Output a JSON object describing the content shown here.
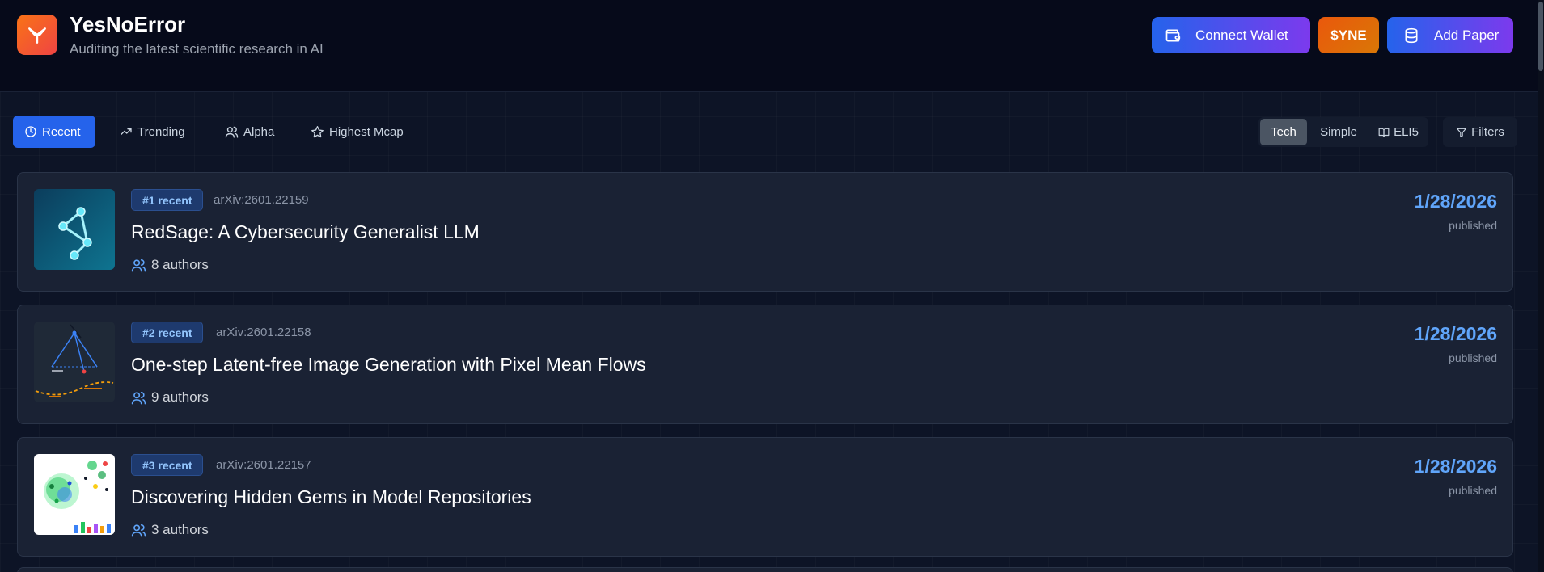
{
  "header": {
    "title": "YesNoError",
    "subtitle": "Auditing the latest scientific research in AI",
    "connect_wallet": "Connect Wallet",
    "token": "$YNE",
    "add_paper": "Add Paper"
  },
  "tabs": {
    "recent": "Recent",
    "trending": "Trending",
    "alpha": "Alpha",
    "highest_mcap": "Highest Mcap"
  },
  "modes": {
    "tech": "Tech",
    "simple": "Simple",
    "eli5": "ELI5",
    "selected": "Tech"
  },
  "filters": "Filters",
  "papers": [
    {
      "rank": "#1 recent",
      "arxiv": "arXiv:2601.22159",
      "title": "RedSage: A Cybersecurity Generalist LLM",
      "authors": "8 authors",
      "date": "1/28/2026",
      "status": "published"
    },
    {
      "rank": "#2 recent",
      "arxiv": "arXiv:2601.22158",
      "title": "One-step Latent-free Image Generation with Pixel Mean Flows",
      "authors": "9 authors",
      "date": "1/28/2026",
      "status": "published"
    },
    {
      "rank": "#3 recent",
      "arxiv": "arXiv:2601.22157",
      "title": "Discovering Hidden Gems in Model Repositories",
      "authors": "3 authors",
      "date": "1/28/2026",
      "status": "published"
    }
  ],
  "colors": {
    "accent": "#2563eb",
    "date": "#60a5fa",
    "brand_gradient_start": "#f97316",
    "brand_gradient_end": "#ef4444"
  }
}
